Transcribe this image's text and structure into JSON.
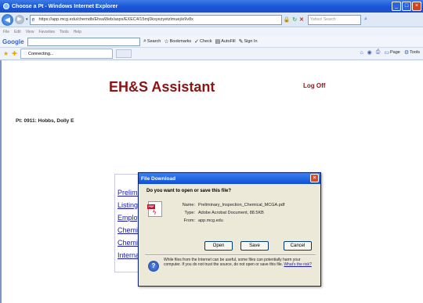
{
  "browser": {
    "title": "Choose a Pt - Windows Internet Explorer",
    "url": "https://app.mcg.edu/chemdb/EhsaWeb/aspx/EXEC4/15mj0ksyezyetzlmuej/e9v8x",
    "search_placeholder": "Yahoo! Search",
    "menu": [
      "File",
      "Edit",
      "View",
      "Favorites",
      "Tools",
      "Help"
    ],
    "google_label": "Google",
    "google_items": [
      "Search",
      "Bookmarks",
      "Check",
      "AutoFill",
      "Sign In"
    ],
    "tab_label": "Connecting...",
    "command_items": [
      "Page",
      "Tools"
    ]
  },
  "app": {
    "title": "EH&S Assistant",
    "logoff": "Log Off",
    "patient": "Pt: 0911: Hobbs, Dolly E",
    "menu_links": [
      "Prelimi",
      "Listing",
      "Employ",
      "Chemic",
      "Chemic",
      "Internal"
    ]
  },
  "dialog": {
    "title": "File Download",
    "question": "Do you want to open or save this file?",
    "name_label": "Name:",
    "name_value": "Preliminary_Inspection_Chemical_MCGA.pdf",
    "type_label": "Type:",
    "type_value": "Adobe Acrobat Document, 88.5KB",
    "from_label": "From:",
    "from_value": "app.mcg.edu",
    "open_label": "Open",
    "save_label": "Save",
    "cancel_label": "Cancel",
    "warning": "While files from the Internet can be useful, some files can potentially harm your computer. If you do not trust the source, do not open or save this file.",
    "risk_link": "What's the risk?"
  },
  "colors": {
    "app_title": "#8b1414",
    "link": "#1a1ab0",
    "titlebar": "#1a55d6"
  }
}
